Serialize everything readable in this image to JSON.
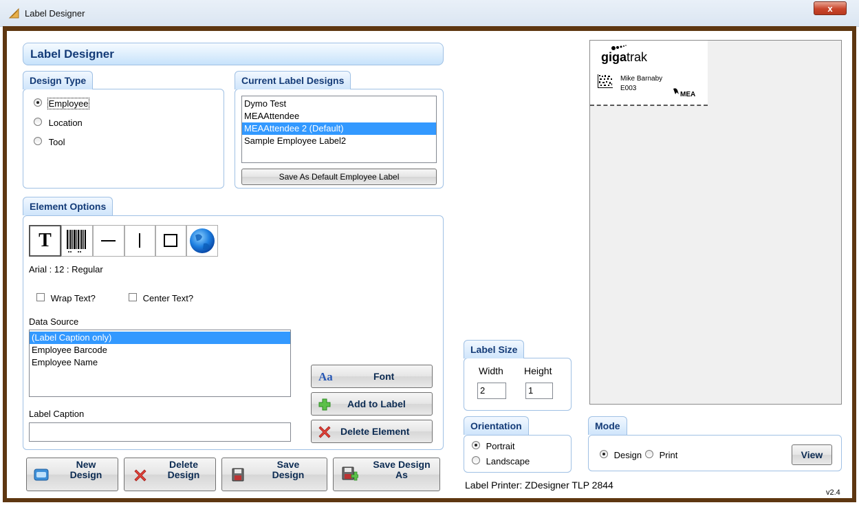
{
  "window": {
    "title": "Label Designer",
    "close_label": "x"
  },
  "header": {
    "title": "Label Designer"
  },
  "design_type": {
    "title": "Design Type",
    "options": [
      {
        "label": "Employee",
        "selected": true
      },
      {
        "label": "Location",
        "selected": false
      },
      {
        "label": "Tool",
        "selected": false
      }
    ]
  },
  "current_designs": {
    "title": "Current Label Designs",
    "items": [
      "Dymo Test",
      "MEAAttendee",
      "MEAAttendee 2  (Default)",
      "Sample Employee Label2"
    ],
    "selected_index": 2,
    "save_default_label": "Save As Default Employee Label"
  },
  "element_options": {
    "title": "Element Options",
    "tools": [
      "text-tool-icon",
      "barcode-tool-icon",
      "horizontal-line-tool-icon",
      "vertical-line-tool-icon",
      "rectangle-tool-icon",
      "image-tool-icon"
    ],
    "font_desc": "Arial : 12 : Regular",
    "wrap_text": "Wrap Text?",
    "center_text": "Center Text?",
    "data_source_label": "Data Source",
    "data_sources": [
      "(Label Caption only)",
      "Employee Barcode",
      "Employee Name"
    ],
    "data_source_selected": 0,
    "caption_label": "Label Caption",
    "caption_value": "",
    "font_btn": "Font",
    "font_icon_text": "Aa",
    "add_btn": "Add to Label",
    "delete_btn": "Delete Element"
  },
  "bottom_buttons": {
    "new_line1": "New",
    "new_line2": "Design",
    "delete_line1": "Delete",
    "delete_line2": "Design",
    "save_line1": "Save",
    "save_line2": "Design",
    "saveas_line1": "Save Design",
    "saveas_line2": "As"
  },
  "label_size": {
    "title": "Label Size",
    "width_label": "Width",
    "height_label": "Height",
    "width": "2",
    "height": "1"
  },
  "orientation": {
    "title": "Orientation",
    "options": [
      {
        "label": "Portrait",
        "selected": true
      },
      {
        "label": "Landscape",
        "selected": false
      }
    ]
  },
  "printer": {
    "text": "Label Printer:  ZDesigner TLP 2844"
  },
  "preview": {
    "logo_prefix": "giga",
    "logo_suffix": "trak",
    "name": "Mike Barnaby",
    "code": "E003",
    "brand": "MEA"
  },
  "mode": {
    "title": "Mode",
    "options": [
      {
        "label": "Design",
        "selected": true
      },
      {
        "label": "Print",
        "selected": false
      }
    ],
    "view_btn": "View"
  },
  "version": "v2.4",
  "colors": {
    "frame": "#5e3711",
    "accent": "#143b77",
    "selection": "#3399ff"
  }
}
